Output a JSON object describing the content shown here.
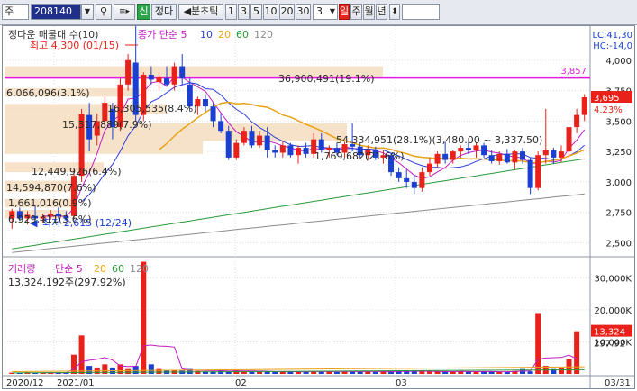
{
  "toolbar": {
    "market_label": "주",
    "code_value": "208140",
    "new_badge": "신",
    "name_label": "정다",
    "period_tick": "분초틱",
    "period_buttons": [
      "1",
      "3",
      "5",
      "10",
      "20",
      "30"
    ],
    "period_selected": "3",
    "day_label": "일",
    "week_label": "주",
    "month_label": "월",
    "year_label": "년"
  },
  "price_panel": {
    "legend_name": "정다운 매물대 수(10)",
    "legend_ma": "종가 단순 5",
    "legend_ma_periods": [
      "10",
      "20",
      "60",
      "120"
    ],
    "high_label": "최고 4,300 (01/15)",
    "low_label": "최저 2,615 (12/24)",
    "lc_label": "LC:41,30",
    "hc_label": "HC:-14,0",
    "volume_profile_labels": [
      "36,900,491(19.1%)",
      "6,066,096(3.1%)",
      "16,305,535(8.4%)",
      "15,317,889(7.9%)",
      "54,334,951(28.1%)(3,480.00 ~ 3,337.50)",
      "1,769,682(21.6%)",
      "12,449,926(6.4%)",
      "14,594,870(7.6%)",
      "1,661,016(0.9%)",
      "6,929,411(3.6%)"
    ],
    "resistance_value": "3,857",
    "price_tag": "3,695",
    "change_tag": "4.23%",
    "y_ticks": [
      "4,000",
      "3,750",
      "3,500",
      "3,250",
      "3,000",
      "2,750",
      "2,500"
    ],
    "colors": {
      "up": "#e8221a",
      "down": "#1b3fd1",
      "ma5": "#c01bc0",
      "ma10": "#2a3bd8",
      "ma20": "#e8a316",
      "ma60": "#2a9a3a",
      "ma120": "#8c8c8c",
      "resistance": "#e21ce0",
      "profile": "#f6e2c8"
    }
  },
  "volume_panel": {
    "legend_name": "거래량",
    "legend_ma": "단순 5",
    "legend_ma_periods": [
      "20",
      "60",
      "120"
    ],
    "volume_text": "13,324,192주(297.92%)",
    "y_ticks": [
      "30,000K",
      "20,000K",
      "10,000K"
    ],
    "volume_tag": "13,324",
    "pct_tag": "297.92"
  },
  "x_axis": {
    "labels": [
      "2020/12",
      "2021/01",
      "02",
      "03",
      "03/31"
    ]
  },
  "chart_data": {
    "type": "candlestick",
    "y_unit": "KRW",
    "candles": [
      {
        "o": 2700,
        "h": 2780,
        "l": 2615,
        "c": 2760
      },
      {
        "o": 2760,
        "h": 2790,
        "l": 2680,
        "c": 2700
      },
      {
        "o": 2700,
        "h": 2760,
        "l": 2650,
        "c": 2730
      },
      {
        "o": 2720,
        "h": 2800,
        "l": 2690,
        "c": 2700
      },
      {
        "o": 2700,
        "h": 2740,
        "l": 2660,
        "c": 2715
      },
      {
        "o": 2720,
        "h": 2770,
        "l": 2690,
        "c": 2740
      },
      {
        "o": 2740,
        "h": 2790,
        "l": 2700,
        "c": 2720
      },
      {
        "o": 2720,
        "h": 2760,
        "l": 2680,
        "c": 2700
      },
      {
        "o": 2720,
        "h": 3100,
        "l": 2700,
        "c": 3050
      },
      {
        "o": 3050,
        "h": 3600,
        "l": 3000,
        "c": 3560
      },
      {
        "o": 3550,
        "h": 3650,
        "l": 3250,
        "c": 3350
      },
      {
        "o": 3380,
        "h": 3560,
        "l": 3300,
        "c": 3500
      },
      {
        "o": 3500,
        "h": 3700,
        "l": 3450,
        "c": 3650
      },
      {
        "o": 3600,
        "h": 3650,
        "l": 3350,
        "c": 3450
      },
      {
        "o": 3450,
        "h": 3850,
        "l": 3420,
        "c": 3800
      },
      {
        "o": 3800,
        "h": 4050,
        "l": 3750,
        "c": 4000
      },
      {
        "o": 3980,
        "h": 4300,
        "l": 3500,
        "c": 3550
      },
      {
        "o": 3550,
        "h": 3900,
        "l": 3500,
        "c": 3880
      },
      {
        "o": 3880,
        "h": 3950,
        "l": 3800,
        "c": 3840
      },
      {
        "o": 3820,
        "h": 3900,
        "l": 3750,
        "c": 3860
      },
      {
        "o": 3850,
        "h": 3950,
        "l": 3780,
        "c": 3800
      },
      {
        "o": 3800,
        "h": 3980,
        "l": 3750,
        "c": 3950
      },
      {
        "o": 3950,
        "h": 4050,
        "l": 3800,
        "c": 3850
      },
      {
        "o": 3800,
        "h": 3850,
        "l": 3600,
        "c": 3620
      },
      {
        "o": 3620,
        "h": 3700,
        "l": 3550,
        "c": 3680
      },
      {
        "o": 3680,
        "h": 3720,
        "l": 3580,
        "c": 3620
      },
      {
        "o": 3620,
        "h": 3650,
        "l": 3450,
        "c": 3500
      },
      {
        "o": 3500,
        "h": 3560,
        "l": 3400,
        "c": 3420
      },
      {
        "o": 3420,
        "h": 3460,
        "l": 3180,
        "c": 3200
      },
      {
        "o": 3200,
        "h": 3350,
        "l": 3180,
        "c": 3320
      },
      {
        "o": 3320,
        "h": 3450,
        "l": 3300,
        "c": 3420
      },
      {
        "o": 3420,
        "h": 3460,
        "l": 3280,
        "c": 3300
      },
      {
        "o": 3300,
        "h": 3420,
        "l": 3280,
        "c": 3380
      },
      {
        "o": 3380,
        "h": 3450,
        "l": 3200,
        "c": 3260
      },
      {
        "o": 3260,
        "h": 3300,
        "l": 3200,
        "c": 3240
      },
      {
        "o": 3240,
        "h": 3340,
        "l": 3200,
        "c": 3300
      },
      {
        "o": 3300,
        "h": 3320,
        "l": 3200,
        "c": 3220
      },
      {
        "o": 3220,
        "h": 3300,
        "l": 3150,
        "c": 3280
      },
      {
        "o": 3280,
        "h": 3320,
        "l": 3200,
        "c": 3230
      },
      {
        "o": 3230,
        "h": 3400,
        "l": 3200,
        "c": 3350
      },
      {
        "o": 3350,
        "h": 3400,
        "l": 3240,
        "c": 3260
      },
      {
        "o": 3260,
        "h": 3300,
        "l": 3200,
        "c": 3280
      },
      {
        "o": 3280,
        "h": 3320,
        "l": 3220,
        "c": 3240
      },
      {
        "o": 3240,
        "h": 3330,
        "l": 3200,
        "c": 3310
      },
      {
        "o": 3310,
        "h": 3480,
        "l": 3250,
        "c": 3290
      },
      {
        "o": 3290,
        "h": 3320,
        "l": 3200,
        "c": 3220
      },
      {
        "o": 3220,
        "h": 3300,
        "l": 3180,
        "c": 3260
      },
      {
        "o": 3260,
        "h": 3290,
        "l": 3180,
        "c": 3200
      },
      {
        "o": 3200,
        "h": 3260,
        "l": 3150,
        "c": 3220
      },
      {
        "o": 3220,
        "h": 3240,
        "l": 3050,
        "c": 3080
      },
      {
        "o": 3080,
        "h": 3120,
        "l": 3000,
        "c": 3030
      },
      {
        "o": 3030,
        "h": 3100,
        "l": 2950,
        "c": 3000
      },
      {
        "o": 3000,
        "h": 3060,
        "l": 2900,
        "c": 2950
      },
      {
        "o": 2950,
        "h": 3120,
        "l": 2920,
        "c": 3080
      },
      {
        "o": 3080,
        "h": 3200,
        "l": 3050,
        "c": 3150
      },
      {
        "o": 3150,
        "h": 3250,
        "l": 3120,
        "c": 3230
      },
      {
        "o": 3230,
        "h": 3330,
        "l": 3150,
        "c": 3180
      },
      {
        "o": 3180,
        "h": 3260,
        "l": 3150,
        "c": 3250
      },
      {
        "o": 3250,
        "h": 3300,
        "l": 3200,
        "c": 3280
      },
      {
        "o": 3280,
        "h": 3330,
        "l": 3230,
        "c": 3260
      },
      {
        "o": 3260,
        "h": 3320,
        "l": 3200,
        "c": 3300
      },
      {
        "o": 3300,
        "h": 3320,
        "l": 3200,
        "c": 3220
      },
      {
        "o": 3220,
        "h": 3260,
        "l": 3150,
        "c": 3170
      },
      {
        "o": 3170,
        "h": 3250,
        "l": 3140,
        "c": 3230
      },
      {
        "o": 3230,
        "h": 3270,
        "l": 3150,
        "c": 3160
      },
      {
        "o": 3160,
        "h": 3260,
        "l": 3100,
        "c": 3250
      },
      {
        "o": 3250,
        "h": 3280,
        "l": 3150,
        "c": 3180
      },
      {
        "o": 3180,
        "h": 3200,
        "l": 2900,
        "c": 2950
      },
      {
        "o": 2950,
        "h": 3250,
        "l": 2930,
        "c": 3220
      },
      {
        "o": 3220,
        "h": 3600,
        "l": 3150,
        "c": 3260
      },
      {
        "o": 3260,
        "h": 3280,
        "l": 3150,
        "c": 3200
      },
      {
        "o": 3200,
        "h": 3300,
        "l": 3160,
        "c": 3250
      },
      {
        "o": 3250,
        "h": 3400,
        "l": 3200,
        "c": 3450
      },
      {
        "o": 3450,
        "h": 3600,
        "l": 3400,
        "c": 3550
      },
      {
        "o": 3550,
        "h": 3720,
        "l": 3500,
        "c": 3695
      }
    ],
    "volume": [
      400,
      300,
      500,
      350,
      300,
      400,
      300,
      400,
      6000,
      12000,
      2500,
      2000,
      3000,
      2000,
      3000,
      1500,
      2500,
      35000,
      3000,
      1500,
      1000,
      1200,
      1000,
      1500,
      900,
      800,
      800,
      1000,
      900,
      1100,
      800,
      700,
      900,
      700,
      600,
      800,
      700,
      600,
      700,
      800,
      800,
      700,
      600,
      700,
      900,
      600,
      800,
      600,
      700,
      800,
      900,
      1000,
      800,
      700,
      700,
      800,
      700,
      600,
      900,
      700,
      600,
      800,
      700,
      600,
      700,
      900,
      1500,
      800,
      19000,
      2500,
      1500,
      1800,
      4500,
      13324
    ],
    "resistance": 3857,
    "ylim": [
      2400,
      4250
    ],
    "volume_ylim": [
      0,
      36000
    ]
  }
}
